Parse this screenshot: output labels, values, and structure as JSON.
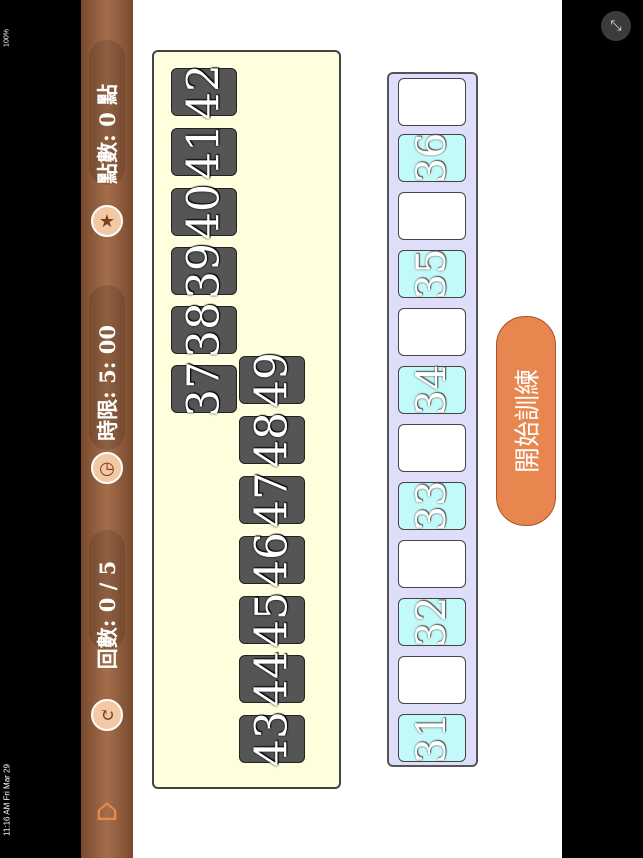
{
  "status_bar": {
    "time": "11:16 AM   Fri Mar 29",
    "battery": "100%"
  },
  "sidebar": {
    "rounds_label": "回數: 0 / 5",
    "time_label": "時限: 5: 00",
    "points_label": "點數: 0 點",
    "icons": {
      "home": "home-icon",
      "rounds": "refresh-icon",
      "clock": "clock-icon",
      "star": "star-icon"
    }
  },
  "board": {
    "tiles": [
      "37",
      "38",
      "39",
      "40",
      "41",
      "42",
      "43",
      "44",
      "45",
      "46",
      "47",
      "48",
      "49"
    ]
  },
  "track": {
    "slots": [
      "31",
      "",
      "32",
      "",
      "33",
      "",
      "34",
      "",
      "35",
      "",
      "36",
      ""
    ]
  },
  "start_button": {
    "label": "開始訓練"
  },
  "colors": {
    "accent": "#e7864e",
    "sidebar": "#8a5637",
    "board": "#ffffdd",
    "slot_filled": "#c2fafa"
  }
}
